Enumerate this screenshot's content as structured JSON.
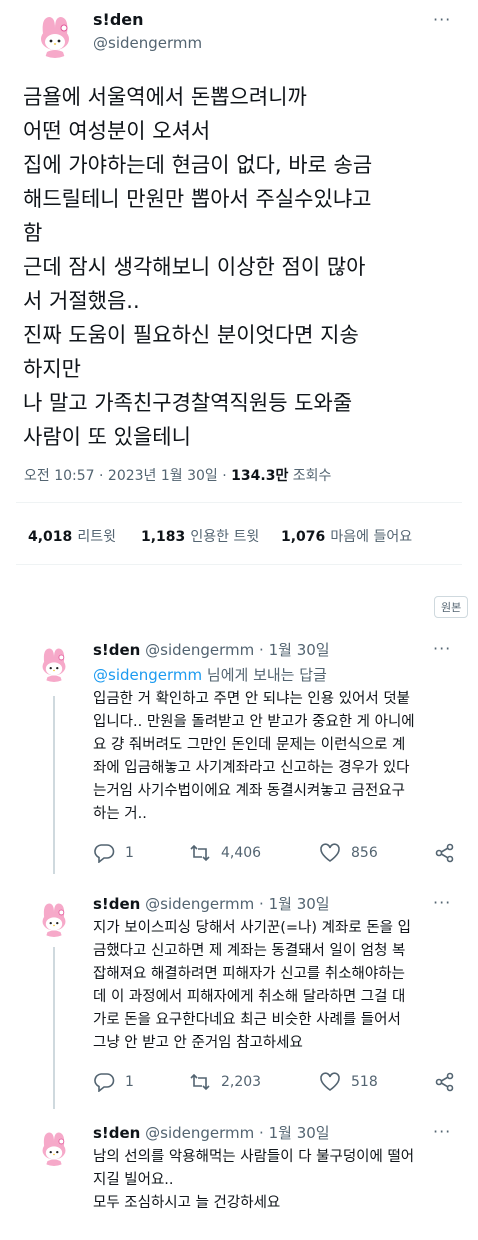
{
  "main": {
    "display_name": "s!den",
    "handle": "@sidengermm",
    "more": "···",
    "text": "금욜에 서울역에서 돈뽑으려니까\n어떤 여성분이 오셔서\n집에 가야하는데 현금이 없다, 바로 송금\n해드릴테니 만원만 뽑아서 주실수있냐고\n함\n근데 잠시 생각해보니 이상한 점이 많아\n서 거절했음..\n진짜 도움이 필요하신 분이엇다면 지송\n하지만\n나 말고 가족친구경찰역직원등 도와줄\n사람이 또 있을테니",
    "time": "오전 10:57 · 2023년 1월 30일 ·",
    "views_num": "134.3만",
    "views_label": "조회수",
    "stats": [
      {
        "num": "4,018",
        "label": "리트윗"
      },
      {
        "num": "1,183",
        "label": "인용한 트윗"
      },
      {
        "num": "1,076",
        "label": "마음에 들어요"
      }
    ],
    "badge": "원본"
  },
  "replies": [
    {
      "display_name": "s!den",
      "handle": "@sidengermm",
      "date": "· 1월 30일",
      "more": "···",
      "reply_to_handle": "@sidengermm",
      "reply_to_suffix": "님에게 보내는 답글",
      "text": "입금한 거 확인하고 주면 안 되냐는 인용 있어서 덧붙\n입니다.. 만원을 돌려받고 안 받고가 중요한 게 아니에\n요 걍 줘버려도 그만인 돈인데 문제는 이런식으로 계\n좌에 입금해놓고 사기계좌라고 신고하는 경우가 있다\n는거임 사기수법이에요 계좌 동결시켜놓고 금전요구\n하는 거..",
      "replies": "1",
      "retweets": "4,406",
      "likes": "856"
    },
    {
      "display_name": "s!den",
      "handle": "@sidengermm",
      "date": "· 1월 30일",
      "more": "···",
      "text": "지가 보이스피싱 당해서 사기꾼(=나) 계좌로 돈을 입\n금했다고 신고하면 제 계좌는 동결돼서 일이 엄청 복\n잡해져요 해결하려면 피해자가 신고를 취소해야하는\n데 이 과정에서 피해자에게 취소해 달라하면 그걸 대\n가로 돈을 요구한다네요 최근 비슷한 사례를 들어서\n그냥 안 받고 안 준거임 참고하세요",
      "replies": "1",
      "retweets": "2,203",
      "likes": "518"
    },
    {
      "display_name": "s!den",
      "handle": "@sidengermm",
      "date": "· 1월 30일",
      "more": "···",
      "text": "남의 선의를 악용해먹는 사람들이 다 불구덩이에 떨어\n지길 빌어요..\n모두 조심하시고 늘 건강하세요"
    }
  ],
  "colors": {
    "accent": "#1d9bf0",
    "muted": "#536471",
    "text": "#0f1419"
  }
}
